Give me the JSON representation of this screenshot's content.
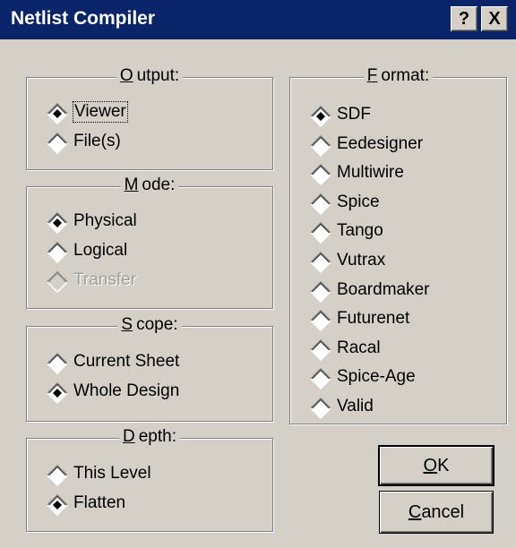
{
  "window": {
    "title": "Netlist Compiler",
    "help_button": "?",
    "close_button": "X"
  },
  "output": {
    "title_accel": "O",
    "title_rest": "utput:",
    "options": [
      {
        "label": "Viewer",
        "selected": true,
        "disabled": false
      },
      {
        "label": "File(s)",
        "selected": false,
        "disabled": false
      }
    ]
  },
  "mode": {
    "title_accel": "M",
    "title_rest": "ode:",
    "options": [
      {
        "label": "Physical",
        "selected": true,
        "disabled": false
      },
      {
        "label": "Logical",
        "selected": false,
        "disabled": false
      },
      {
        "label": "Transfer",
        "selected": false,
        "disabled": true
      }
    ]
  },
  "scope": {
    "title_accel": "S",
    "title_rest": "cope:",
    "options": [
      {
        "label": "Current Sheet",
        "selected": false,
        "disabled": false
      },
      {
        "label": "Whole Design",
        "selected": true,
        "disabled": false
      }
    ]
  },
  "depth": {
    "title_accel": "D",
    "title_rest": "epth:",
    "options": [
      {
        "label": "This Level",
        "selected": false,
        "disabled": false
      },
      {
        "label": "Flatten",
        "selected": true,
        "disabled": false
      }
    ]
  },
  "format": {
    "title_accel": "F",
    "title_rest": "ormat:",
    "options": [
      {
        "label": "SDF",
        "selected": true,
        "disabled": false
      },
      {
        "label": "Eedesigner",
        "selected": false,
        "disabled": false
      },
      {
        "label": "Multiwire",
        "selected": false,
        "disabled": false
      },
      {
        "label": "Spice",
        "selected": false,
        "disabled": false
      },
      {
        "label": "Tango",
        "selected": false,
        "disabled": false
      },
      {
        "label": "Vutrax",
        "selected": false,
        "disabled": false
      },
      {
        "label": "Boardmaker",
        "selected": false,
        "disabled": false
      },
      {
        "label": "Futurenet",
        "selected": false,
        "disabled": false
      },
      {
        "label": "Racal",
        "selected": false,
        "disabled": false
      },
      {
        "label": "Spice-Age",
        "selected": false,
        "disabled": false
      },
      {
        "label": "Valid",
        "selected": false,
        "disabled": false
      }
    ]
  },
  "buttons": {
    "ok_accel": "O",
    "ok_rest": "K",
    "cancel_accel": "C",
    "cancel_rest": "ancel"
  }
}
